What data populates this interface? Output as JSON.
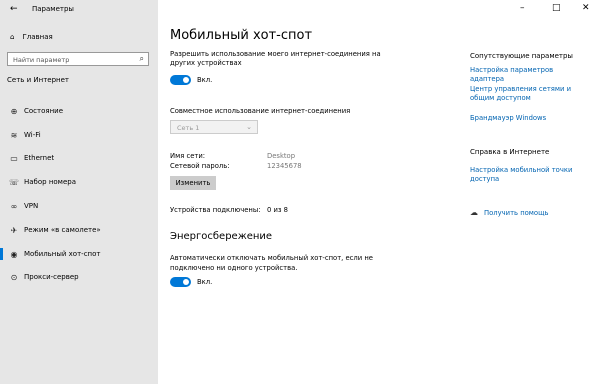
{
  "window": {
    "title": "Параметры",
    "back_icon": "arrow-left-icon",
    "controls": [
      "–",
      "□",
      "✕"
    ]
  },
  "sidebar": {
    "home_label": "Главная",
    "home_icon": "home-icon",
    "search_placeholder": "Найти параметр",
    "search_icon": "search-icon",
    "section_title": "Сеть и Интернет",
    "items": [
      {
        "label": "Состояние",
        "icon": "globe-icon",
        "glyph": "⊕"
      },
      {
        "label": "Wi-Fi",
        "icon": "wifi-icon",
        "glyph": "≋"
      },
      {
        "label": "Ethernet",
        "icon": "ethernet-icon",
        "glyph": "▭"
      },
      {
        "label": "Набор номера",
        "icon": "phone-icon",
        "glyph": "☏"
      },
      {
        "label": "VPN",
        "icon": "vpn-icon",
        "glyph": "∞"
      },
      {
        "label": "Режим «в самолете»",
        "icon": "airplane-icon",
        "glyph": "✈"
      },
      {
        "label": "Мобильный хот-спот",
        "icon": "hotspot-icon",
        "glyph": "◉",
        "selected": true
      },
      {
        "label": "Прокси-сервер",
        "icon": "proxy-icon",
        "glyph": "⊙"
      }
    ]
  },
  "main": {
    "title": "Мобильный хот-спот",
    "share_desc_line1": "Разрешить использование моего интернет-соединения на",
    "share_desc_line2": "других устройствах",
    "share_toggle_label": "Вкл.",
    "share_from_label": "Совместное использование интернет-соединения",
    "share_from_value": "Сеть 1",
    "network_name_label": "Имя сети:",
    "network_name_value": "Desktop",
    "password_label": "Сетевой пароль:",
    "password_value": "12345678",
    "edit_button": "Изменить",
    "devices_label": "Устройства подключены:",
    "devices_value": "0 из 8",
    "power_title": "Энергосбережение",
    "power_desc_line1": "Автоматически отключать мобильный хот-спот, если не",
    "power_desc_line2": "подключено ни одного устройства.",
    "power_toggle_label": "Вкл."
  },
  "right": {
    "related_title": "Сопутствующие параметры",
    "links": [
      "Настройка параметров адаптера",
      "Центр управления сетями и общим доступом",
      "Брандмауэр Windows"
    ],
    "help_title": "Справка в Интернете",
    "help_link": "Настройка мобильной точки доступа",
    "get_help_label": "Получить помощь",
    "get_help_icon": "chat-help-icon"
  },
  "colors": {
    "accent": "#0078d7",
    "link": "#0063b1",
    "sidebar_bg": "#e6e6e6"
  }
}
